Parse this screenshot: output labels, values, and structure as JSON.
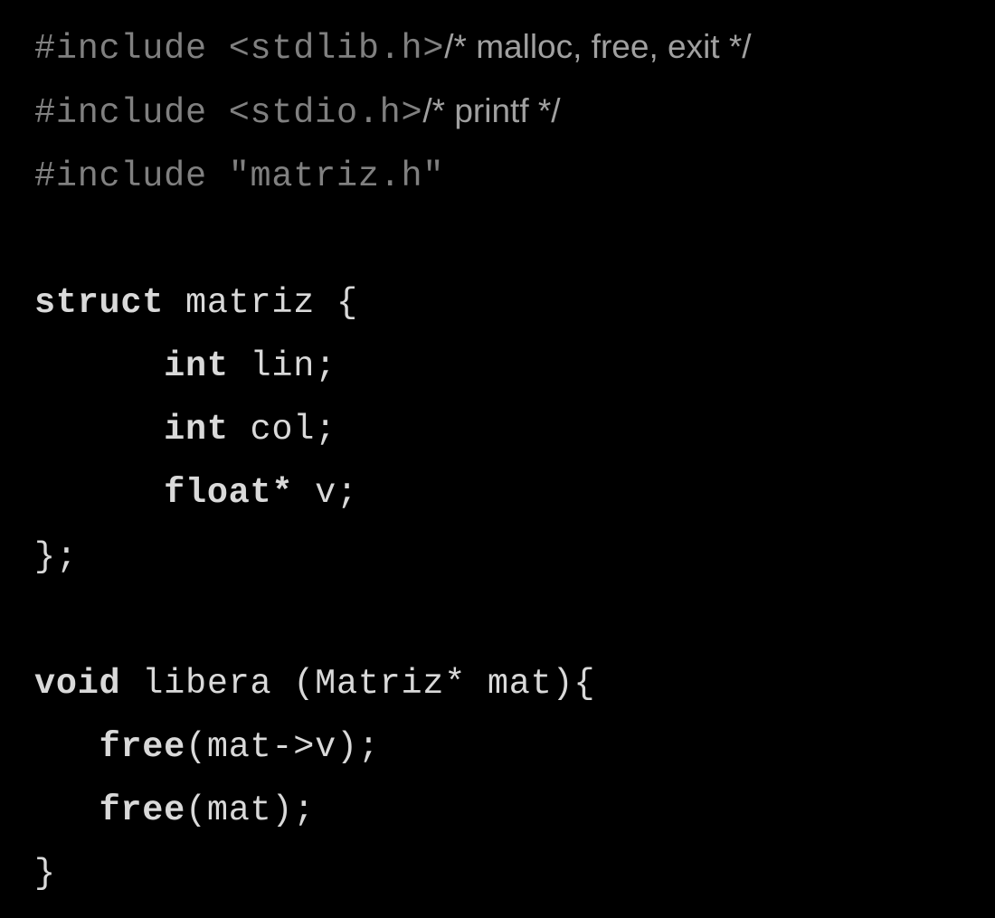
{
  "code": {
    "inc1_a": "#include",
    "inc1_b": "<stdlib.h>",
    "inc1_c": "/* malloc, free, exit */",
    "inc2_a": "#include",
    "inc2_b": "<stdio.h>",
    "inc2_c": "/* printf */",
    "inc3_a": "#include",
    "inc3_b": "\"matriz.h\"",
    "kw_struct": "struct",
    "struct_decl": " matriz {",
    "kw_int1": "int",
    "decl_lin": " lin;",
    "kw_int2": "int",
    "decl_col": " col;",
    "kw_float": "float*",
    "decl_v": " v;",
    "struct_close": "};",
    "kw_void": "void",
    "fn_decl": " libera (Matriz* mat){",
    "kw_free1": "free",
    "free1_arg": "(mat->v);",
    "kw_free2": "free",
    "free2_arg": "(mat);",
    "fn_close": "}"
  }
}
